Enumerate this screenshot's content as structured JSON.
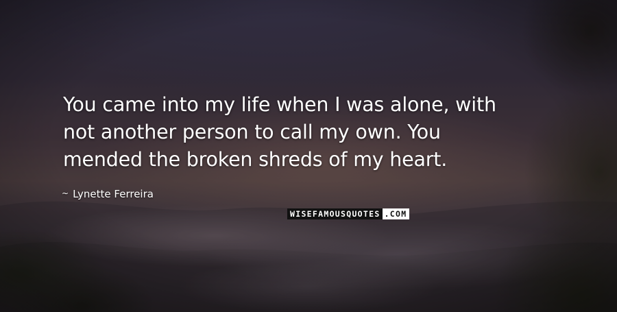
{
  "quote": {
    "lines": [
      "You came into my life when I was alone, with",
      "not another person to call my own. You",
      "mended the broken shreds of my heart."
    ]
  },
  "author": {
    "dash": "~",
    "name": "Lynette Ferreira"
  },
  "brand": {
    "main": "WISEFAMOUSQUOTES",
    "tld": ".COM"
  },
  "colors": {
    "text": "#ffffff",
    "brand_bg": "#111111",
    "brand_tld_bg": "#ffffff"
  }
}
